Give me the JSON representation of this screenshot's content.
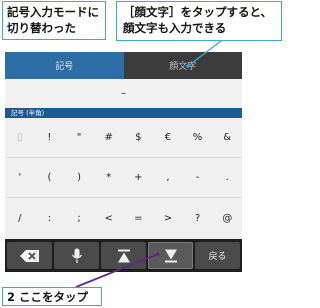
{
  "callouts": {
    "left": {
      "line1": "記号入力モードに",
      "line2": "切り替わった"
    },
    "right": {
      "line1": "［顔文字］をタップすると、",
      "line2": "顔文字も入力できる"
    },
    "step": {
      "number": "2",
      "text": "ここをタップ"
    }
  },
  "tabs": {
    "symbols": "記号",
    "emoticons": "顔文字"
  },
  "input_text": "–",
  "category_label": "記号 (半角)",
  "symbol_rows": [
    [
      "▯",
      "!",
      "\"",
      "#",
      "$",
      "€",
      "%",
      "&"
    ],
    [
      "'",
      "(",
      ")",
      "*",
      "+",
      ",",
      "-",
      "."
    ],
    [
      "/",
      ":",
      ";",
      "<",
      "=",
      ">",
      "?",
      "@"
    ]
  ],
  "bottom_keys": {
    "backspace_icon": "backspace-icon",
    "mic_icon": "microphone-icon",
    "page_up_icon": "page-up-icon",
    "page_down_icon": "page-down-icon",
    "back_label": "戻る"
  },
  "colors": {
    "accent": "#39a8dc",
    "active_tab": "#2e6ea6",
    "leader_line": "#5b2a86"
  }
}
